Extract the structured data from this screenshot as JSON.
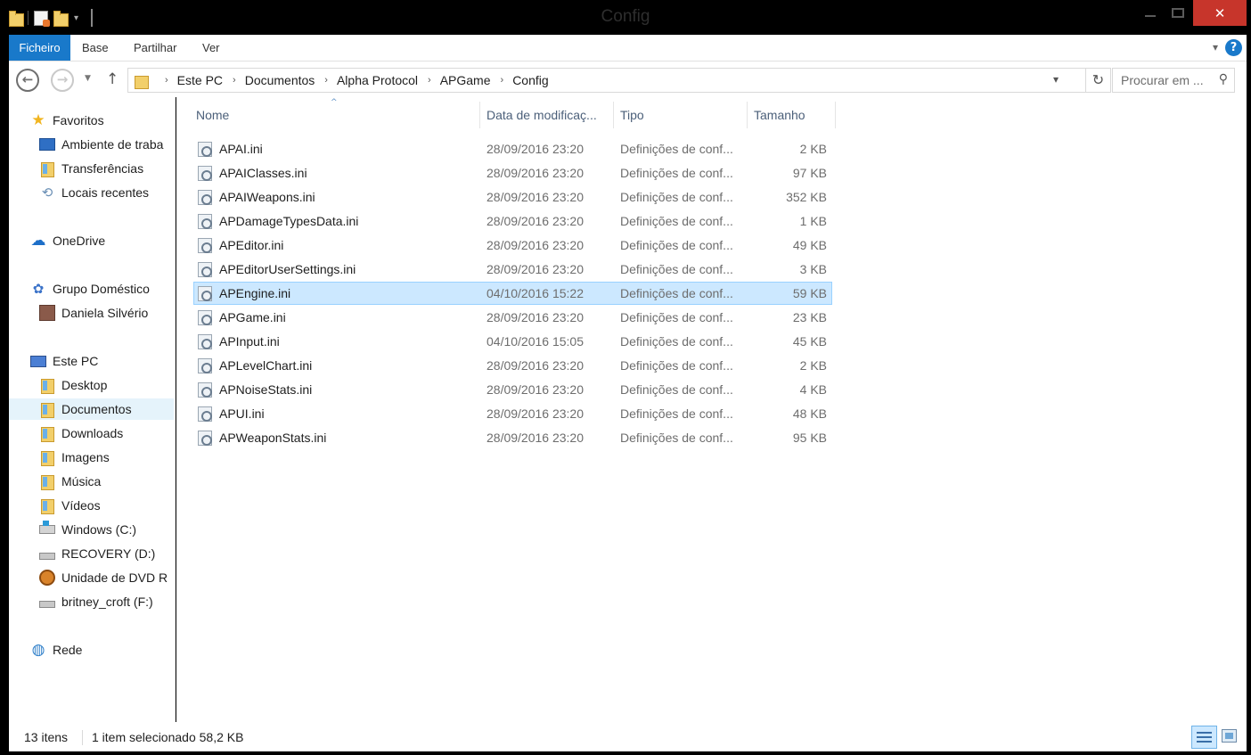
{
  "window": {
    "title": "Config",
    "close_glyph": "✕"
  },
  "ribbon": {
    "tabs": [
      {
        "label": "Ficheiro",
        "active": true
      },
      {
        "label": "Base"
      },
      {
        "label": "Partilhar"
      },
      {
        "label": "Ver"
      }
    ],
    "help_glyph": "?"
  },
  "navigation": {
    "back_glyph": "←",
    "forward_glyph": "→",
    "up_glyph": "↑",
    "breadcrumb": [
      "Este PC",
      "Documentos",
      "Alpha Protocol",
      "APGame",
      "Config"
    ],
    "breadcrumb_separator": "›",
    "search_placeholder": "Procurar em ..."
  },
  "sidebar": {
    "items": [
      {
        "label": "Favoritos",
        "icon": "star-icon"
      },
      {
        "label": "Ambiente de traba",
        "icon": "desktop-icon"
      },
      {
        "label": "Transferências",
        "icon": "downloads-folder-icon"
      },
      {
        "label": "Locais recentes",
        "icon": "recent-places-icon"
      },
      {
        "label": "OneDrive",
        "icon": "onedrive-icon"
      },
      {
        "label": "Grupo Doméstico",
        "icon": "homegroup-icon"
      },
      {
        "label": "Daniela Silvério",
        "icon": "user-avatar-icon"
      },
      {
        "label": "Este PC",
        "icon": "computer-icon"
      },
      {
        "label": "Desktop",
        "icon": "folder-icon"
      },
      {
        "label": "Documentos",
        "icon": "documents-folder-icon",
        "selected": true
      },
      {
        "label": "Downloads",
        "icon": "folder-icon"
      },
      {
        "label": "Imagens",
        "icon": "folder-icon"
      },
      {
        "label": "Música",
        "icon": "folder-icon"
      },
      {
        "label": "Vídeos",
        "icon": "folder-icon"
      },
      {
        "label": "Windows (C:)",
        "icon": "windows-drive-icon"
      },
      {
        "label": "RECOVERY (D:)",
        "icon": "drive-icon"
      },
      {
        "label": "Unidade de DVD R",
        "icon": "dvd-drive-icon"
      },
      {
        "label": "britney_croft (F:)",
        "icon": "drive-icon"
      },
      {
        "label": "Rede",
        "icon": "network-icon"
      }
    ]
  },
  "file_list": {
    "columns": {
      "name": "Nome",
      "date": "Data de modificaç...",
      "type": "Tipo",
      "size": "Tamanho"
    },
    "sort_glyph": "^",
    "rows": [
      {
        "name": "APAI.ini",
        "date": "28/09/2016 23:20",
        "type": "Definições de conf...",
        "size": "2 KB"
      },
      {
        "name": "APAIClasses.ini",
        "date": "28/09/2016 23:20",
        "type": "Definições de conf...",
        "size": "97 KB"
      },
      {
        "name": "APAIWeapons.ini",
        "date": "28/09/2016 23:20",
        "type": "Definições de conf...",
        "size": "352 KB"
      },
      {
        "name": "APDamageTypesData.ini",
        "date": "28/09/2016 23:20",
        "type": "Definições de conf...",
        "size": "1 KB"
      },
      {
        "name": "APEditor.ini",
        "date": "28/09/2016 23:20",
        "type": "Definições de conf...",
        "size": "49 KB"
      },
      {
        "name": "APEditorUserSettings.ini",
        "date": "28/09/2016 23:20",
        "type": "Definições de conf...",
        "size": "3 KB"
      },
      {
        "name": "APEngine.ini",
        "date": "04/10/2016 15:22",
        "type": "Definições de conf...",
        "size": "59 KB",
        "selected": true
      },
      {
        "name": "APGame.ini",
        "date": "28/09/2016 23:20",
        "type": "Definições de conf...",
        "size": "23 KB"
      },
      {
        "name": "APInput.ini",
        "date": "04/10/2016 15:05",
        "type": "Definições de conf...",
        "size": "45 KB"
      },
      {
        "name": "APLevelChart.ini",
        "date": "28/09/2016 23:20",
        "type": "Definições de conf...",
        "size": "2 KB"
      },
      {
        "name": "APNoiseStats.ini",
        "date": "28/09/2016 23:20",
        "type": "Definições de conf...",
        "size": "4 KB"
      },
      {
        "name": "APUI.ini",
        "date": "28/09/2016 23:20",
        "type": "Definições de conf...",
        "size": "48 KB"
      },
      {
        "name": "APWeaponStats.ini",
        "date": "28/09/2016 23:20",
        "type": "Definições de conf...",
        "size": "95 KB"
      }
    ]
  },
  "status": {
    "count": "13 itens",
    "selection": "1 item selecionado  58,2 KB"
  },
  "colors": {
    "accent": "#1979ca",
    "selection": "#cce8ff",
    "close_button": "#c7352b"
  }
}
